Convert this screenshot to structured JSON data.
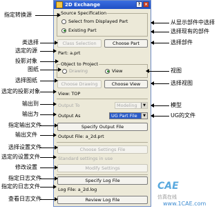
{
  "dialog": {
    "title": "2D Exchange",
    "source_group_label": "Source Specification",
    "source_options": [
      "Select from Displayed Part",
      "Existing Part"
    ],
    "class_selection_label": "Class Selection",
    "choose_part_label": "Choose Part",
    "part_text": "Part: a.prt",
    "object_group_label": "Object to Project",
    "object_options": [
      "Drawing",
      "View"
    ],
    "choose_drawing_label": "Choose Drawing",
    "choose_view_label": "Choose View",
    "view_text": "View: TOP",
    "output_to_label": "Output To",
    "output_to_value": "Modeling",
    "output_as_label": "Output As",
    "output_as_value": "UG Part File",
    "specify_output_label": "Specify Output File",
    "output_file_text": "Output File: a_2d.prt",
    "choose_settings_label": "Choose Settings File",
    "standard_settings_text": "Standard settings in use",
    "modify_settings_label": "Modify Settings",
    "specify_log_label": "Specify Log File",
    "log_file_text": "Log File: a_2d.log",
    "review_log_label": "Review Log File"
  },
  "annotations": {
    "left": [
      "指定转换源",
      "类选择",
      "选定的源",
      "投影对象",
      "图纸",
      "选择图纸",
      "选定的投影对象",
      "输出到",
      "输出为",
      "指定输出文件",
      "输出文件",
      "选择设置文件",
      "选定的设置文件",
      "修改设置",
      "指定日志文件",
      "指定的日志文件",
      "查看日志文件"
    ],
    "right": [
      "从显示部件中选择",
      "选择现有的部件",
      "选择部件",
      "视图",
      "选择视图",
      "模型",
      "UG的文件"
    ]
  },
  "watermark": {
    "brand": "CAE",
    "sub": "仿真在线",
    "url": "www.1CAE.com"
  }
}
